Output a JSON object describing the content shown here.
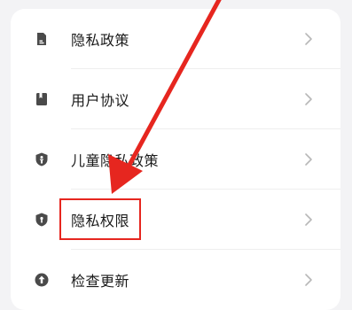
{
  "settings_menu": {
    "items": [
      {
        "label": "隐私政策",
        "icon": "document-icon"
      },
      {
        "label": "用户协议",
        "icon": "agreement-icon"
      },
      {
        "label": "儿童隐私政策",
        "icon": "child-icon"
      },
      {
        "label": "隐私权限",
        "icon": "shield-icon"
      },
      {
        "label": "检查更新",
        "icon": "upgrade-icon"
      }
    ]
  },
  "colors": {
    "annotation_red": "#e6261f",
    "icon_gray": "#4a4a4a",
    "chevron_gray": "#b8b8b8"
  }
}
